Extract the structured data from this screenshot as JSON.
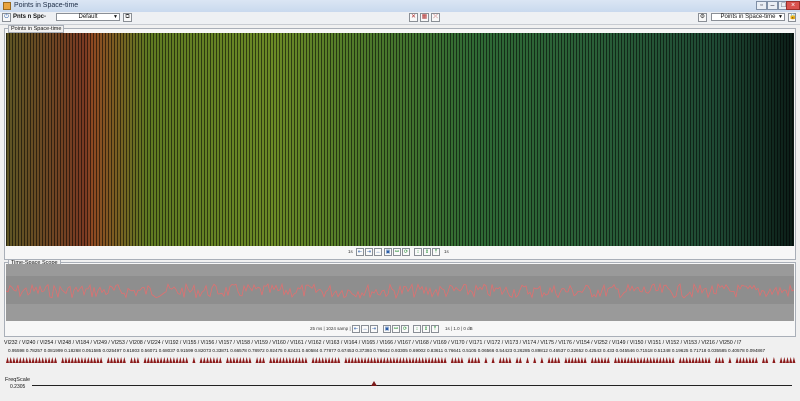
{
  "window": {
    "title": "Points in Space-time",
    "icon": "points-app-icon"
  },
  "toolbar": {
    "left_label": "Pnts n Spc-",
    "preset_value": "Default",
    "right_select_value": "Points in Space-time"
  },
  "spacetime_panel": {
    "title": "Points in Space-time",
    "left_hint": "1s",
    "right_hint": "1s"
  },
  "scope_panel": {
    "title": "Time-Space Scope",
    "info_left": "25 ms | 1024 samp | 1s",
    "info_right": "1s | 1.0 | 0 dB",
    "trace_color": "#e07070"
  },
  "channels_text": "VI232 / VI240 / VI254 / VI248 / VI184 / VI249 / VI253 / VI208 / VI224 / VI192 / VI155 / VI156 / VI157 / VI158 / VI159 / VI160 / VI161 / VI162 / VI163 / VI164 / VI165 / VI166 / VI167 / VI168 / VI169 / VI170 / VI171 / VI172 / VI173 / VI174 / VI175 / VI176 / VI154 / VI252 / VI149 / VI150 / VI151 / VI152 / VI153 / VI216 / VI250 / I7",
  "values_text": "0.95598 0.78257 0.081999 0.18268 0.051585 0.025497 0.61803 0.56071 0.68037 0.91599 0.82073 0.33871 0.66578 0.78972 0.92475 0.62431 0.60584 0.77877 0.67453 0.37393 0.76642 0.93305 0.69002 0.83611 0.76641 0.5105 0.06566 0.54423 0.26285 0.89812 0.46537 0.32652 0.42543 0.433 0.045546 0.71518 0.51348 0.19625 0.71718 0.035585 0.40578 0.094867",
  "freq_scale": {
    "label": "FreqScale",
    "value": "0.2305",
    "position": 0.2305
  },
  "colors": {
    "marker": "#8b1a1a",
    "accent": "#2a5da8"
  }
}
